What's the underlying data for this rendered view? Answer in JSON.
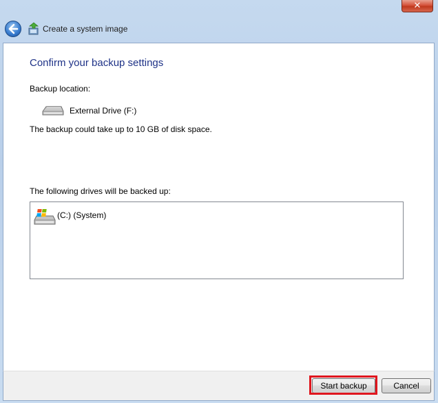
{
  "window": {
    "title": "Create a system image",
    "close_glyph": "✕"
  },
  "page": {
    "heading": "Confirm your backup settings",
    "backup_location_label": "Backup location:",
    "backup_location_value": "External Drive (F:)",
    "space_note": "The backup could take up to 10 GB of disk space.",
    "drives_label": "The following drives will be backed up:",
    "drives": [
      {
        "label": "(C:) (System)",
        "icon": "windows-drive-icon"
      }
    ]
  },
  "buttons": {
    "start_backup": "Start backup",
    "cancel": "Cancel"
  },
  "colors": {
    "heading": "#1e3287",
    "highlight": "#e0161e",
    "close_button": "#c0391e"
  }
}
